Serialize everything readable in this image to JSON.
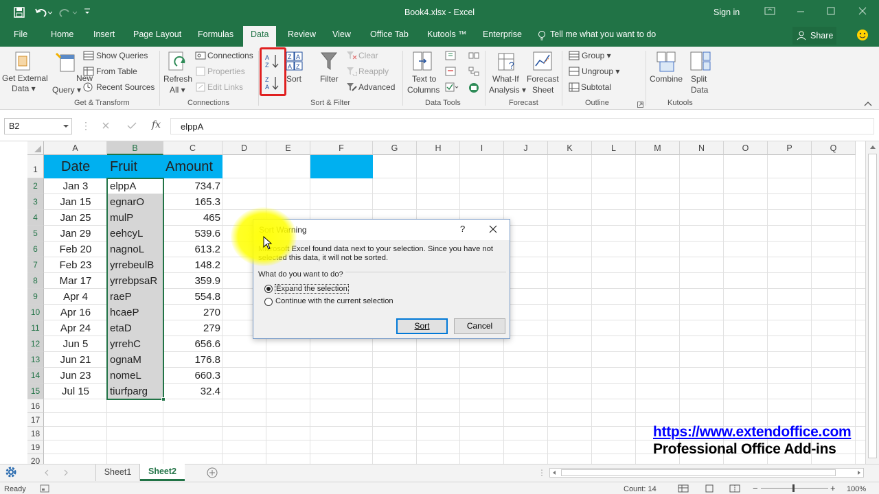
{
  "window": {
    "title": "Book4.xlsx  -  Excel",
    "sign_in": "Sign in"
  },
  "menu_tabs": [
    "File",
    "Home",
    "Insert",
    "Page Layout",
    "Formulas",
    "Data",
    "Review",
    "View",
    "Office Tab",
    "Kutools ™",
    "Enterprise"
  ],
  "tell_me": "Tell me what you want to do",
  "share": "Share",
  "ribbon": {
    "get_external": [
      "Get External",
      "Data ▾"
    ],
    "new_query": [
      "New",
      "Query ▾"
    ],
    "show_queries": "Show Queries",
    "from_table": "From Table",
    "recent_sources": "Recent Sources",
    "group_get_transform": "Get & Transform",
    "refresh_all": [
      "Refresh",
      "All ▾"
    ],
    "connections": "Connections",
    "properties": "Properties",
    "edit_links": "Edit Links",
    "group_connections": "Connections",
    "sort": "Sort",
    "filter": "Filter",
    "clear": "Clear",
    "reapply": "Reapply",
    "advanced": "Advanced",
    "group_sort_filter": "Sort & Filter",
    "text_to_columns": [
      "Text to",
      "Columns"
    ],
    "group_data_tools": "Data Tools",
    "what_if": [
      "What-If",
      "Analysis ▾"
    ],
    "forecast_sheet": [
      "Forecast",
      "Sheet"
    ],
    "group_forecast": "Forecast",
    "group": "Group ▾",
    "ungroup": "Ungroup ▾",
    "subtotal": "Subtotal",
    "group_outline": "Outline",
    "combine": "Combine",
    "split_data": [
      "Split",
      "Data"
    ],
    "group_kutools": "Kutools"
  },
  "formula_bar": {
    "name_box": "B2",
    "fx": "fx",
    "value": "elppA"
  },
  "columns": [
    "A",
    "B",
    "C",
    "D",
    "E",
    "F",
    "G",
    "H",
    "I",
    "J",
    "K",
    "L",
    "M",
    "N",
    "O",
    "P",
    "Q"
  ],
  "rows": [
    "1",
    "2",
    "3",
    "4",
    "5",
    "6",
    "7",
    "8",
    "9",
    "10",
    "11",
    "12",
    "13",
    "14",
    "15",
    "16",
    "17",
    "18",
    "19",
    "20"
  ],
  "headers": {
    "date": "Date",
    "fruit": "Fruit",
    "amount": "Amount"
  },
  "table": [
    [
      "Jan 3",
      "elppA",
      "734.7"
    ],
    [
      "Jan 15",
      "egnarO",
      "165.3"
    ],
    [
      "Jan 25",
      "mulP",
      "465"
    ],
    [
      "Jan 29",
      "eehcyL",
      "539.6"
    ],
    [
      "Feb 20",
      "nagnoL",
      "613.2"
    ],
    [
      "Feb 23",
      "yrrebeulB",
      "148.2"
    ],
    [
      "Mar 17",
      "yrrebpsaR",
      "359.9"
    ],
    [
      "Apr 4",
      "raeP",
      "554.8"
    ],
    [
      "Apr 16",
      "hcaeP",
      "270"
    ],
    [
      "Apr 24",
      "etaD",
      "279"
    ],
    [
      "Jun 5",
      "yrrehC",
      "656.6"
    ],
    [
      "Jun 21",
      "ognaM",
      "176.8"
    ],
    [
      "Jun 23",
      "nomeL",
      "660.3"
    ],
    [
      "Jul 15",
      "tiurfparg",
      "32.4"
    ]
  ],
  "dialog": {
    "title": "Sort Warning",
    "help": "?",
    "message_line1": "Microsoft Excel found data next to your selection.  Since you have not",
    "message_line2": "selected this data, it will not be sorted.",
    "question": "What do you want to do?",
    "option_expand": "Expand the selection",
    "option_continue": "Continue with the current selection",
    "sort_button": "Sort",
    "cancel_button": "Cancel"
  },
  "watermark": {
    "url": "https://www.extendoffice.com",
    "tagline": "Professional Office Add-ins"
  },
  "sheets": [
    "Sheet1",
    "Sheet2"
  ],
  "status": {
    "ready": "Ready",
    "count": "Count: 14",
    "zoom": "100%"
  },
  "colors": {
    "excel_green": "#217346",
    "header_fill": "#00b0f0",
    "annotation_red": "#e02020",
    "highlight_yellow": "#ffff00",
    "link_blue": "#0000ff"
  }
}
